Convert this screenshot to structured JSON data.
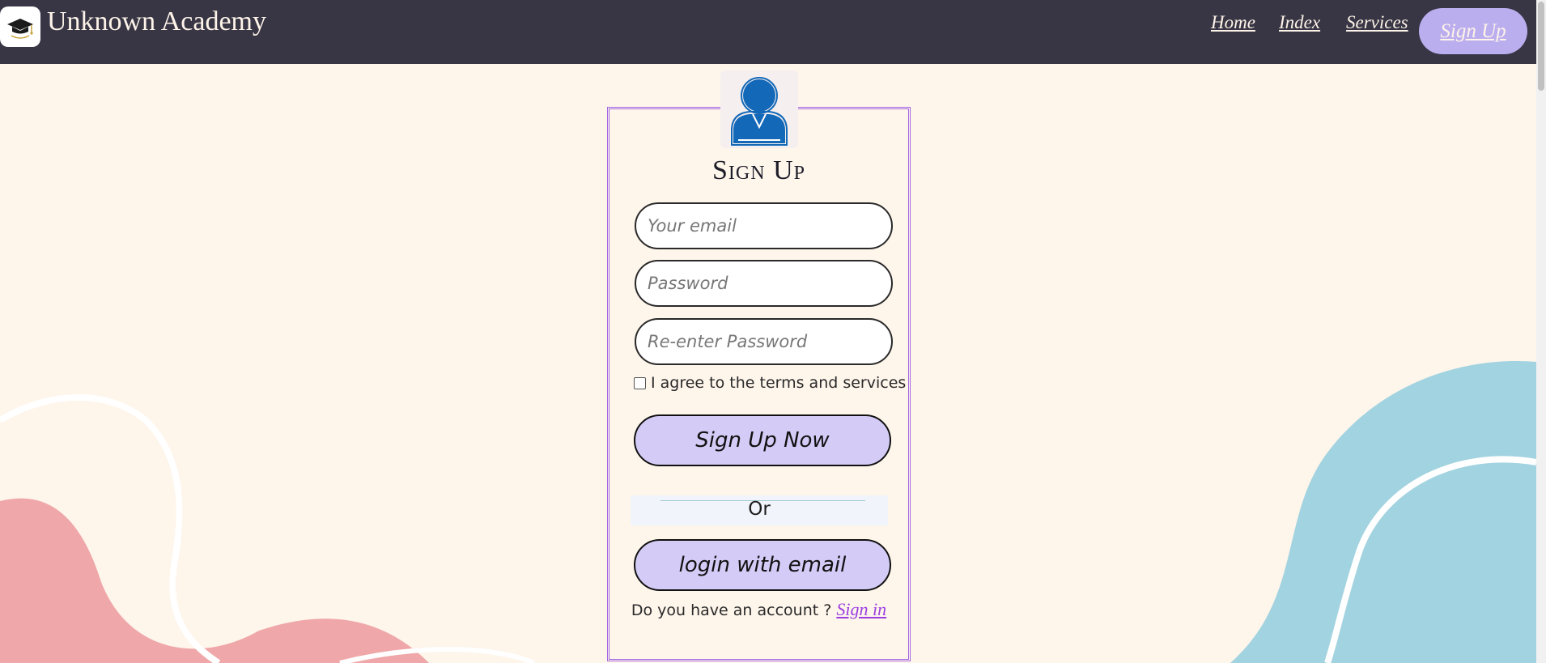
{
  "header": {
    "brand": "Unknown Academy",
    "logo_icon": "graduation-cap-icon",
    "nav": [
      {
        "label": "Home"
      },
      {
        "label": "Index"
      },
      {
        "label": "Services"
      }
    ],
    "signup_label": "Sign Up"
  },
  "form": {
    "avatar_icon": "user-icon",
    "title": "Sign Up",
    "email_placeholder": "Your email",
    "password_placeholder": "Password",
    "reenter_placeholder": "Re-enter Password",
    "agree_label": "I agree to the terms and services",
    "agree_checked": false,
    "submit_label": "Sign Up Now",
    "or_label": "Or",
    "login_label": "login with email",
    "account_prompt": "Do you have an account ?",
    "signin_link": "Sign in"
  },
  "colors": {
    "header_bg": "#383645",
    "page_bg": "#fef5eb",
    "button_bg": "#d4ccf6",
    "nav_signup_bg": "#bbaeef",
    "card_border": "#a265e3",
    "blob_pink": "#efa7a9",
    "blob_blue": "#a2d3e0",
    "avatar_blue": "#1468b8"
  }
}
